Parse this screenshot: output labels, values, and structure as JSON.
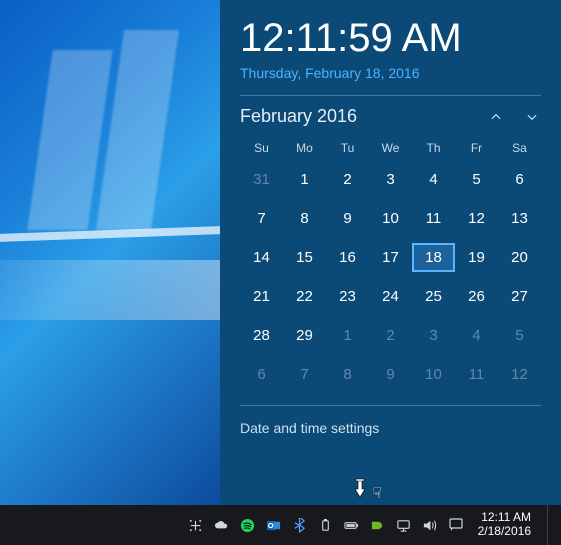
{
  "clock": {
    "time": "12:11:59 AM",
    "long_date": "Thursday, February 18, 2016"
  },
  "calendar": {
    "title": "February 2016",
    "dow": [
      "Su",
      "Mo",
      "Tu",
      "We",
      "Th",
      "Fr",
      "Sa"
    ],
    "today_value": "18",
    "weeks": [
      [
        {
          "d": "31",
          "other": true
        },
        {
          "d": "1"
        },
        {
          "d": "2"
        },
        {
          "d": "3"
        },
        {
          "d": "4"
        },
        {
          "d": "5"
        },
        {
          "d": "6"
        }
      ],
      [
        {
          "d": "7"
        },
        {
          "d": "8"
        },
        {
          "d": "9"
        },
        {
          "d": "10"
        },
        {
          "d": "11"
        },
        {
          "d": "12"
        },
        {
          "d": "13"
        }
      ],
      [
        {
          "d": "14"
        },
        {
          "d": "15"
        },
        {
          "d": "16"
        },
        {
          "d": "17"
        },
        {
          "d": "18",
          "today": true
        },
        {
          "d": "19"
        },
        {
          "d": "20"
        }
      ],
      [
        {
          "d": "21"
        },
        {
          "d": "22"
        },
        {
          "d": "23"
        },
        {
          "d": "24"
        },
        {
          "d": "25"
        },
        {
          "d": "26"
        },
        {
          "d": "27"
        }
      ],
      [
        {
          "d": "28"
        },
        {
          "d": "29"
        },
        {
          "d": "1",
          "other": true
        },
        {
          "d": "2",
          "other": true
        },
        {
          "d": "3",
          "other": true
        },
        {
          "d": "4",
          "other": true
        },
        {
          "d": "5",
          "other": true
        }
      ],
      [
        {
          "d": "6",
          "other": true
        },
        {
          "d": "7",
          "other": true
        },
        {
          "d": "8",
          "other": true
        },
        {
          "d": "9",
          "other": true
        },
        {
          "d": "10",
          "other": true
        },
        {
          "d": "11",
          "other": true
        },
        {
          "d": "12",
          "other": true
        }
      ]
    ]
  },
  "settings_link": "Date and time settings",
  "taskbar": {
    "time": "12:11 AM",
    "date": "2/18/2016"
  }
}
